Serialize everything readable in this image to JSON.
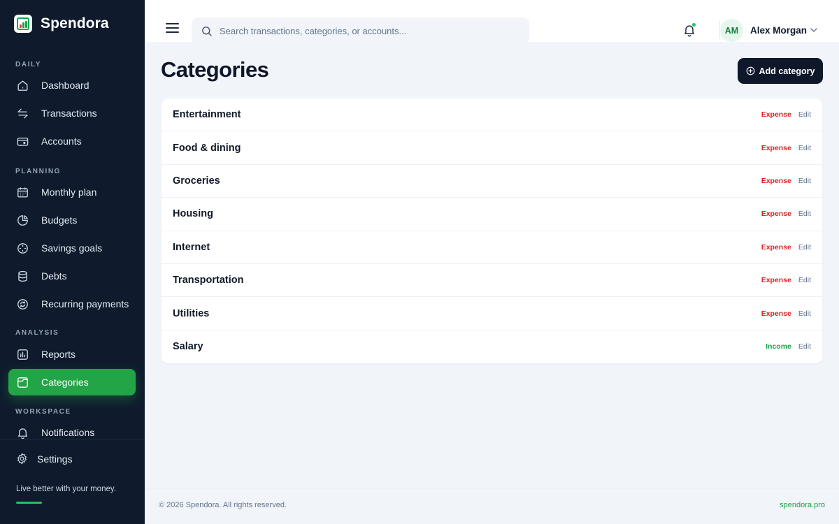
{
  "brand": {
    "name": "Spendora"
  },
  "sidebar": {
    "sections": {
      "daily": "DAILY",
      "planning": "PLANNING",
      "analysis": "ANALYSIS",
      "workspace": "WORKSPACE"
    },
    "items": [
      {
        "label": "Dashboard",
        "icon": "home-icon"
      },
      {
        "label": "Transactions",
        "icon": "arrows-icon"
      },
      {
        "label": "Accounts",
        "icon": "wallet-icon"
      },
      {
        "label": "Monthly plan",
        "icon": "calendar-icon"
      },
      {
        "label": "Budgets",
        "icon": "pie-icon"
      },
      {
        "label": "Savings goals",
        "icon": "target-icon"
      },
      {
        "label": "Debts",
        "icon": "database-icon"
      },
      {
        "label": "Recurring payments",
        "icon": "refresh-icon"
      },
      {
        "label": "Reports",
        "icon": "chart-icon"
      },
      {
        "label": "Categories",
        "icon": "folder-icon",
        "active": true
      },
      {
        "label": "Notifications",
        "icon": "bell-icon"
      }
    ],
    "settings": "Settings",
    "tagline": "Live better with your money."
  },
  "topbar": {
    "search_placeholder": "Search transactions, categories, or accounts...",
    "user": {
      "initials": "AM",
      "name": "Alex Morgan"
    }
  },
  "main": {
    "title": "Categories",
    "add_button": "Add category",
    "categories": [
      {
        "name": "Entertainment",
        "type": "Expense",
        "edit": "Edit"
      },
      {
        "name": "Food & dining",
        "type": "Expense",
        "edit": "Edit"
      },
      {
        "name": "Groceries",
        "type": "Expense",
        "edit": "Edit"
      },
      {
        "name": "Housing",
        "type": "Expense",
        "edit": "Edit"
      },
      {
        "name": "Internet",
        "type": "Expense",
        "edit": "Edit"
      },
      {
        "name": "Transportation",
        "type": "Expense",
        "edit": "Edit"
      },
      {
        "name": "Utilities",
        "type": "Expense",
        "edit": "Edit"
      },
      {
        "name": "Salary",
        "type": "Income",
        "edit": "Edit"
      }
    ]
  },
  "footer": {
    "copyright": "© 2026 Spendora. All rights reserved.",
    "link": "spendora.pro"
  },
  "colors": {
    "sidebar_bg": "#0f1b2d",
    "accent": "#22a447",
    "expense": "#dc2626",
    "income": "#16a34a"
  }
}
